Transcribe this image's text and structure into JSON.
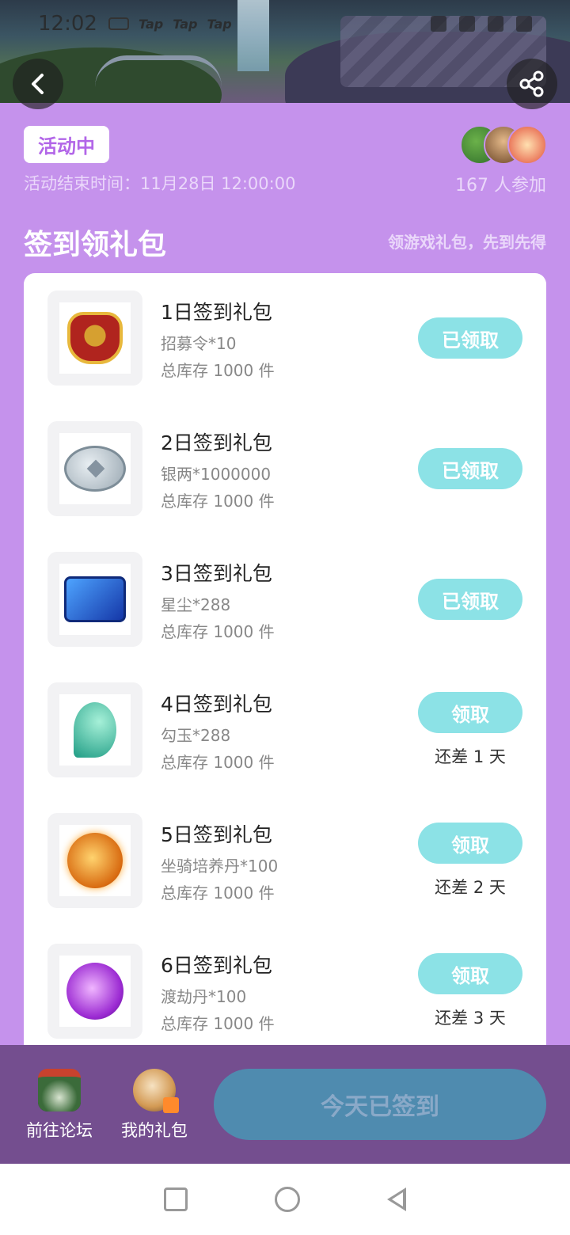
{
  "status_bar": {
    "time": "12:02",
    "tap_labels": [
      "Tap",
      "Tap",
      "Tap"
    ]
  },
  "header": {
    "status": "活动中",
    "end_time": "活动结束时间：11月28日 12:00:00",
    "participants": "167 人参加"
  },
  "section": {
    "title": "签到领礼包",
    "subtitle": "领游戏礼包，先到先得"
  },
  "gifts": [
    {
      "title": "1日签到礼包",
      "item": "招募令*10",
      "stock": "总库存 1000 件",
      "button": "已领取",
      "remain": "",
      "icon": "token-icon"
    },
    {
      "title": "2日签到礼包",
      "item": "银两*1000000",
      "stock": "总库存 1000 件",
      "button": "已领取",
      "remain": "",
      "icon": "coin-icon"
    },
    {
      "title": "3日签到礼包",
      "item": "星尘*288",
      "stock": "总库存 1000 件",
      "button": "已领取",
      "remain": "",
      "icon": "chest-icon"
    },
    {
      "title": "4日签到礼包",
      "item": "勾玉*288",
      "stock": "总库存 1000 件",
      "button": "领取",
      "remain": "还差 1 天",
      "icon": "jade-icon"
    },
    {
      "title": "5日签到礼包",
      "item": "坐骑培养丹*100",
      "stock": "总库存 1000 件",
      "button": "领取",
      "remain": "还差 2 天",
      "icon": "orb-icon"
    },
    {
      "title": "6日签到礼包",
      "item": "渡劫丹*100",
      "stock": "总库存 1000 件",
      "button": "领取",
      "remain": "还差 3 天",
      "icon": "purple-orb-icon"
    }
  ],
  "bottom": {
    "forum_label": "前往论坛",
    "mygift_label": "我的礼包",
    "signed_label": "今天已签到"
  },
  "colors": {
    "background": "#c592ec",
    "claim_button": "#8ce2e6",
    "bottom_bar": "#744e8f",
    "signed_button": "#4f8baf"
  }
}
